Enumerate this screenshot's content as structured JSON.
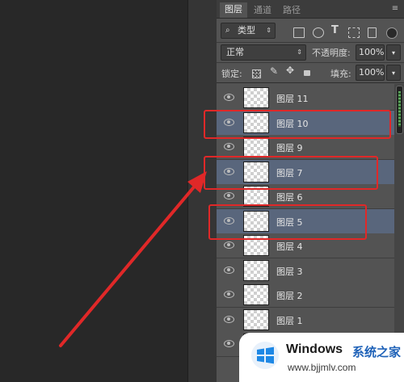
{
  "tabs": [
    {
      "label": "图层",
      "active": true
    },
    {
      "label": "通道",
      "active": false
    },
    {
      "label": "路径",
      "active": false
    }
  ],
  "filter": {
    "kind_label": "类型"
  },
  "blend": {
    "mode": "正常",
    "opacity_label": "不透明度:",
    "opacity_value": "100%"
  },
  "lock": {
    "label": "锁定:",
    "fill_label": "填充:",
    "fill_value": "100%"
  },
  "layers": [
    {
      "name": "图层 11",
      "selected": false
    },
    {
      "name": "图层 10",
      "selected": true
    },
    {
      "name": "图层 9",
      "selected": false
    },
    {
      "name": "图层 7",
      "selected": true
    },
    {
      "name": "图层 6",
      "selected": false
    },
    {
      "name": "图层 5",
      "selected": true
    },
    {
      "name": "图层 4",
      "selected": false
    },
    {
      "name": "图层 3",
      "selected": false
    },
    {
      "name": "图层 2",
      "selected": false
    },
    {
      "name": "图层 1",
      "selected": false
    }
  ],
  "watermark": {
    "brand": "Windows",
    "site_cn": "系统之家",
    "url": "www.bjjmlv.com"
  },
  "colors": {
    "annotation": "#e02828",
    "selected_layer": "#59667c",
    "panel": "#535353"
  }
}
